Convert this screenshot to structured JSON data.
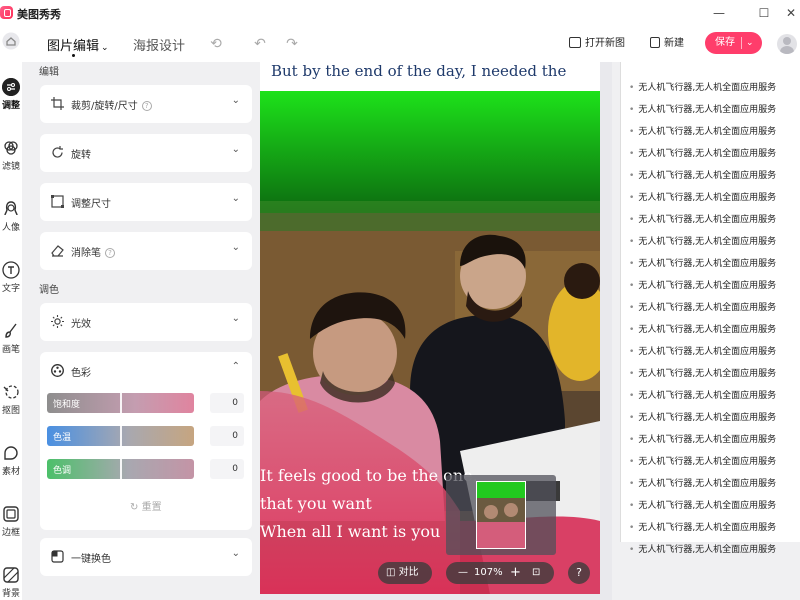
{
  "app": {
    "name": "美图秀秀"
  },
  "window": {
    "minimize": "—",
    "maximize": "☐",
    "close": "✕"
  },
  "nav": [
    {
      "label": "调整",
      "icon": "sliders-icon"
    },
    {
      "label": "滤镜",
      "icon": "filter-icon"
    },
    {
      "label": "人像",
      "icon": "portrait-icon"
    },
    {
      "label": "文字",
      "icon": "text-icon"
    },
    {
      "label": "画笔",
      "icon": "brush-icon"
    },
    {
      "label": "抠图",
      "icon": "cutout-icon"
    },
    {
      "label": "素材",
      "icon": "sticker-icon"
    },
    {
      "label": "边框",
      "icon": "frame-icon"
    },
    {
      "label": "背景",
      "icon": "background-icon"
    }
  ],
  "toolbar": {
    "tab_edit": "图片编辑",
    "tab_poster": "海报设计",
    "open_new": "打开新图",
    "new": "新建",
    "save": "保存"
  },
  "panel": {
    "edit_section": "编辑",
    "crop": "裁剪/旋转/尺寸",
    "rotate": "旋转",
    "resize": "调整尺寸",
    "eraser": "消除笔",
    "tone_section": "调色",
    "light": "光效",
    "color": "色彩",
    "saturation": {
      "label": "饱和度",
      "value": "0",
      "level": 0.5
    },
    "temperature": {
      "label": "色温",
      "value": "0",
      "level": 0.5
    },
    "tint": {
      "label": "色调",
      "value": "0",
      "level": 0.5
    },
    "reset": "重置",
    "one_click_color": "一键换色"
  },
  "canvas": {
    "top_text": "But by the end of the day, I needed the",
    "lyrics": [
      "It feels good to be the one,",
      "that you want",
      "When all I want is you"
    ],
    "compare": "对比",
    "zoom": "107%"
  },
  "right_list": {
    "item_text": "无人机飞行器,无人机全面应用服务",
    "count": 22
  },
  "colors": {
    "accent": "#ff3d6b"
  }
}
